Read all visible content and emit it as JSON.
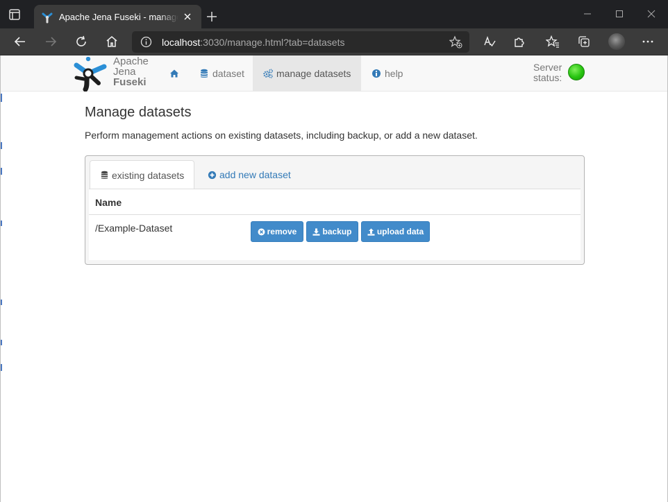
{
  "browser": {
    "tab_title": "Apache Jena Fuseki - manage datasets",
    "url_host": "localhost",
    "url_rest": ":3030/manage.html?tab=datasets"
  },
  "navbar": {
    "logo_lines": [
      "Apache",
      "Jena",
      "Fuseki"
    ],
    "items": [
      {
        "label": "",
        "icon": "home-icon"
      },
      {
        "label": "dataset",
        "icon": "database-icon"
      },
      {
        "label": "manage datasets",
        "icon": "cogs-icon",
        "active": true
      },
      {
        "label": "help",
        "icon": "info-icon"
      }
    ],
    "server_status_lines": [
      "Server",
      "status:"
    ],
    "server_status_color": "#27c410"
  },
  "main": {
    "title": "Manage datasets",
    "description": "Perform management actions on existing datasets, including backup, or add a new dataset.",
    "tabs": [
      {
        "label": "existing datasets",
        "icon": "database-icon",
        "active": true
      },
      {
        "label": "add new dataset",
        "icon": "plus-circle-icon",
        "active": false
      }
    ],
    "table": {
      "columns": [
        "Name"
      ],
      "rows": [
        {
          "name": "/Example-Dataset",
          "actions": [
            {
              "label": "remove",
              "icon": "times-circle-icon"
            },
            {
              "label": "backup",
              "icon": "download-icon"
            },
            {
              "label": "upload data",
              "icon": "upload-icon"
            }
          ]
        }
      ]
    }
  },
  "colors": {
    "primary_button": "#428bca",
    "link": "#337ab7",
    "chrome_dark": "#202124"
  }
}
